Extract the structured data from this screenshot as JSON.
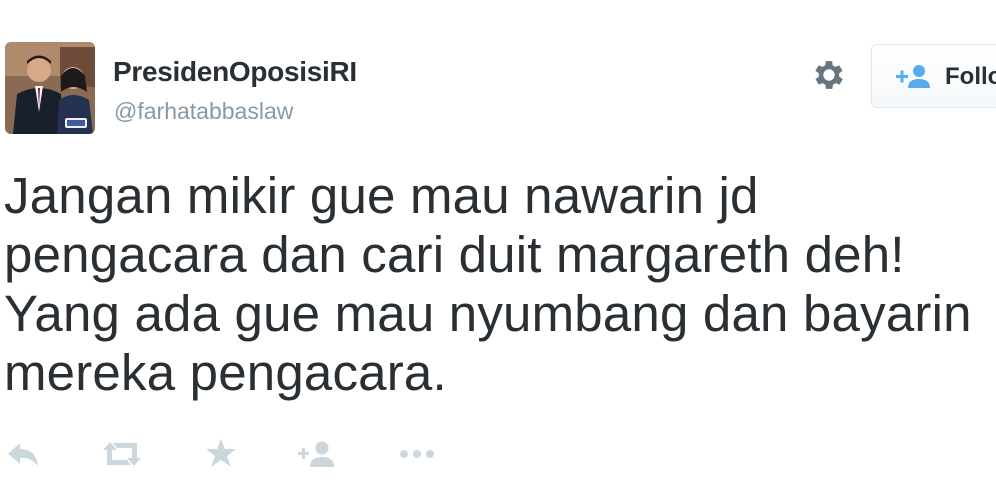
{
  "profile": {
    "fullname": "PresidenOposisiRI",
    "username": "@farhatabbaslaw",
    "avatar_icon": "profile-photo"
  },
  "header_actions": {
    "settings_icon": "gear-icon",
    "follow_label": "Follo",
    "follow_icon": "add-user-icon"
  },
  "tweet": {
    "lines": [
      "Jangan mikir gue mau nawarin jd",
      "pengacara dan cari duit margareth deh!",
      "Yang ada gue mau nyumbang dan bayarin",
      "mereka pengacara."
    ]
  },
  "tweet_actions": [
    {
      "name": "reply-icon"
    },
    {
      "name": "retweet-icon"
    },
    {
      "name": "favorite-icon"
    },
    {
      "name": "follow-icon"
    },
    {
      "name": "more-icon"
    }
  ],
  "colors": {
    "text": "#292f33",
    "muted": "#8899a6",
    "action_icons": "#ccd6dd",
    "follow_icon": "#55acee",
    "border": "#e1e8ed"
  }
}
